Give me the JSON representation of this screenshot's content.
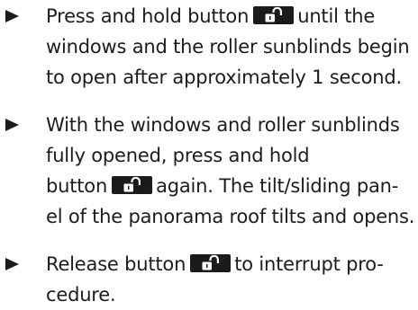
{
  "steps": [
    {
      "lines": {
        "l1_before": "Press and hold button",
        "l1_after": "until the",
        "l2": "windows and the roller sunblinds begin",
        "l3": "to open after approximately 1 second."
      },
      "button_icon": "unlock-icon"
    },
    {
      "lines": {
        "l1": "With the windows and roller sunblinds",
        "l2": "fully opened, press and hold",
        "l3_before": "button",
        "l3_after": "again. The tilt/sliding pan-",
        "l4": "el of the panorama roof tilts and opens."
      },
      "button_icon": "unlock-icon"
    },
    {
      "lines": {
        "l1_before": "Release button",
        "l1_after": "to interrupt pro-",
        "l2": "cedure."
      },
      "button_icon": "unlock-icon"
    }
  ],
  "colors": {
    "text": "#1c1c1c",
    "button_background": "#1b1b1b",
    "icon": "#ffffff"
  }
}
